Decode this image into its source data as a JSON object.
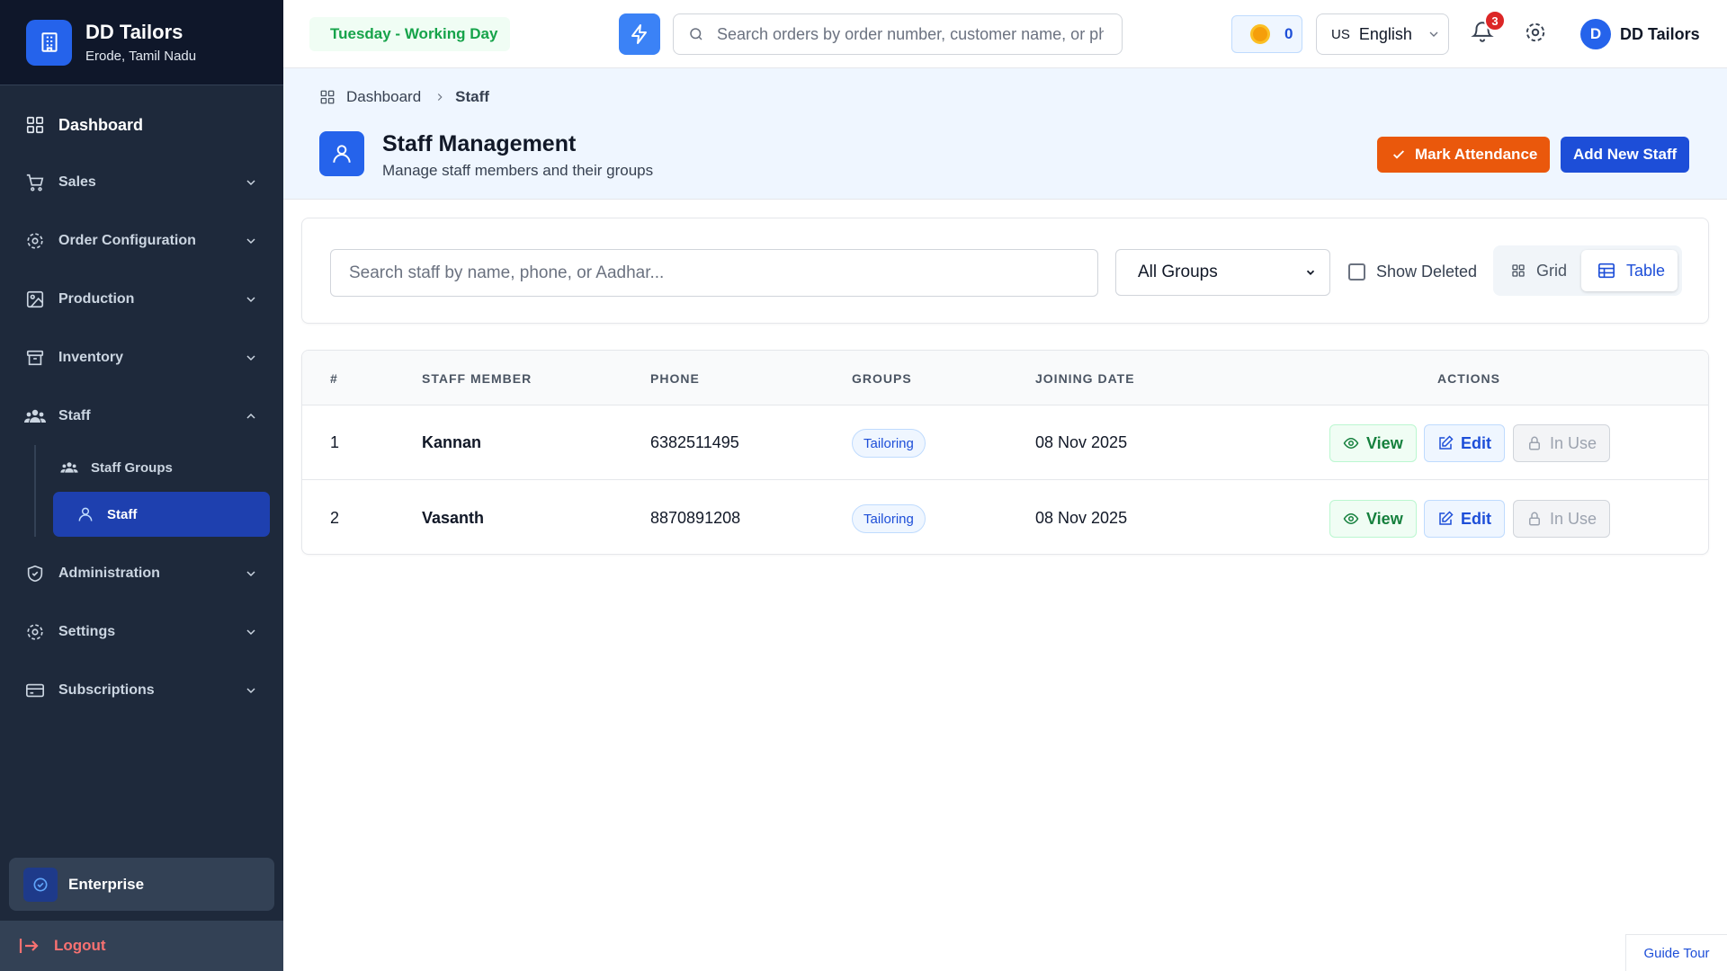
{
  "brand": {
    "name": "DD Tailors",
    "location": "Erode, Tamil Nadu",
    "icon": "building-icon"
  },
  "sidebar": {
    "items": [
      {
        "label": "Dashboard",
        "icon": "grid-icon"
      },
      {
        "label": "Sales",
        "icon": "cart-icon"
      },
      {
        "label": "Order Configuration",
        "icon": "gear-icon"
      },
      {
        "label": "Production",
        "icon": "image-icon"
      },
      {
        "label": "Inventory",
        "icon": "archive-icon"
      },
      {
        "label": "Staff",
        "icon": "users-icon"
      },
      {
        "label": "Administration",
        "icon": "shield-icon"
      },
      {
        "label": "Settings",
        "icon": "gear-icon"
      },
      {
        "label": "Subscriptions",
        "icon": "card-icon"
      }
    ],
    "staff_sub": [
      {
        "label": "Staff Groups",
        "icon": "users-icon"
      },
      {
        "label": "Staff",
        "icon": "user-icon"
      }
    ],
    "plan": "Enterprise",
    "logout": "Logout"
  },
  "topbar": {
    "day_status": "Tuesday - Working Day",
    "search_placeholder": "Search orders by order number, customer name, or phone",
    "coins": "0",
    "lang_flag": "US",
    "language": "English",
    "notifications": "3",
    "user_initial": "D",
    "user_name": "DD Tailors"
  },
  "breadcrumb": {
    "root": "Dashboard",
    "current": "Staff"
  },
  "page": {
    "title": "Staff Management",
    "subtitle": "Manage staff members and their groups",
    "mark_attendance": "Mark Attendance",
    "add_staff": "Add New Staff"
  },
  "filters": {
    "search_placeholder": "Search staff by name, phone, or Aadhar...",
    "group_selected": "All Groups",
    "show_deleted": "Show Deleted",
    "view_grid": "Grid",
    "view_table": "Table"
  },
  "table": {
    "headers": [
      "#",
      "STAFF MEMBER",
      "PHONE",
      "GROUPS",
      "JOINING DATE",
      "ACTIONS"
    ],
    "rows": [
      {
        "num": "1",
        "name": "Kannan",
        "phone": "6382511495",
        "group": "Tailoring",
        "joined": "08 Nov 2025"
      },
      {
        "num": "2",
        "name": "Vasanth",
        "phone": "8870891208",
        "group": "Tailoring",
        "joined": "08 Nov 2025"
      }
    ],
    "actions": {
      "view": "View",
      "edit": "Edit",
      "in_use": "In Use"
    }
  },
  "guide_tour": "Guide Tour",
  "colors": {
    "sidebar": "#1e293b",
    "accent": "#2563eb",
    "orange": "#ea580c",
    "active": "#1e40af"
  }
}
